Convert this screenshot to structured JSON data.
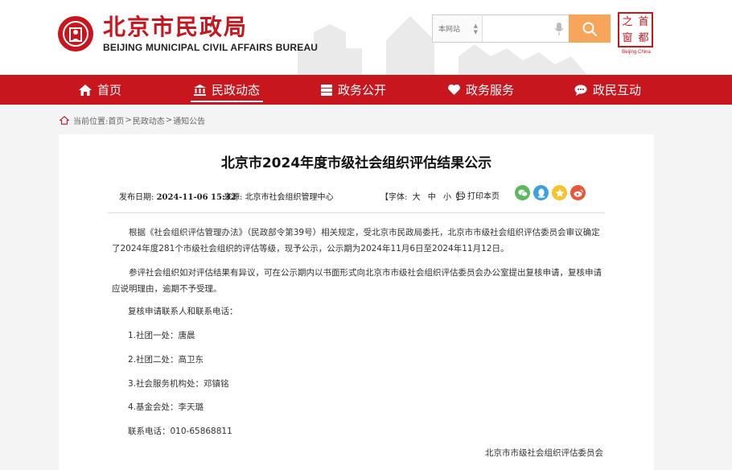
{
  "header": {
    "logo_cn": "北京市民政局",
    "logo_en": "BEIJING MUNICIPAL CIVIL AFFAIRS BUREAU",
    "search_scope": "本网站",
    "search_placeholder": "",
    "capital_chars": [
      "首",
      "都",
      "之",
      "窗"
    ],
    "capital_sub": "Beijing·China"
  },
  "nav": [
    {
      "label": "首页",
      "icon": "home-icon"
    },
    {
      "label": "民政动态",
      "icon": "building-icon"
    },
    {
      "label": "政务公开",
      "icon": "document-icon"
    },
    {
      "label": "政务服务",
      "icon": "heart-icon"
    },
    {
      "label": "政民互动",
      "icon": "chat-icon"
    }
  ],
  "breadcrumb": {
    "label": "当前位置:",
    "items": [
      "首页",
      "民政动态",
      "通知公告"
    ]
  },
  "article": {
    "title": "北京市2024年度市级社会组织评估结果公示",
    "date_label": "发布日期:",
    "date": "2024-11-06 15:32",
    "source_label": "来源:",
    "source": "北京市社会组织管理中心",
    "fontsize_label": "【字体:",
    "fontsize_options": [
      "大",
      "中",
      "小"
    ],
    "fontsize_close": "】",
    "print": "打印本页",
    "paragraphs": [
      "根据《社会组织评估管理办法》（民政部令第39号）相关规定，受北京市民政局委托，北京市市级社会组织评估委员会审议确定了2024年度281个市级社会组织的评估等级，现予公示，公示期为2024年11月6日至2024年11月12日。",
      "参评社会组织如对评估结果有异议，可在公示期内以书面形式向北京市市级社会组织评估委员会办公室提出复核申请，复核申请应说明理由，逾期不予受理。"
    ],
    "lines": [
      "复核申请联系人和联系电话：",
      "1.社团一处：唐晨",
      "2.社团二处：高卫东",
      "3.社会服务机构处：邓镇铭",
      "4.基金会处：李天璐",
      "联系电话：010-65868811"
    ],
    "signature": "北京市市级社会组织评估委员会"
  },
  "colors": {
    "brand_red": "#c8161e",
    "search_button": "#f6a55a",
    "wechat": "#5cb85c",
    "qq": "#3ba1e0",
    "qzone": "#f5c32c",
    "weibo": "#e8573c"
  }
}
